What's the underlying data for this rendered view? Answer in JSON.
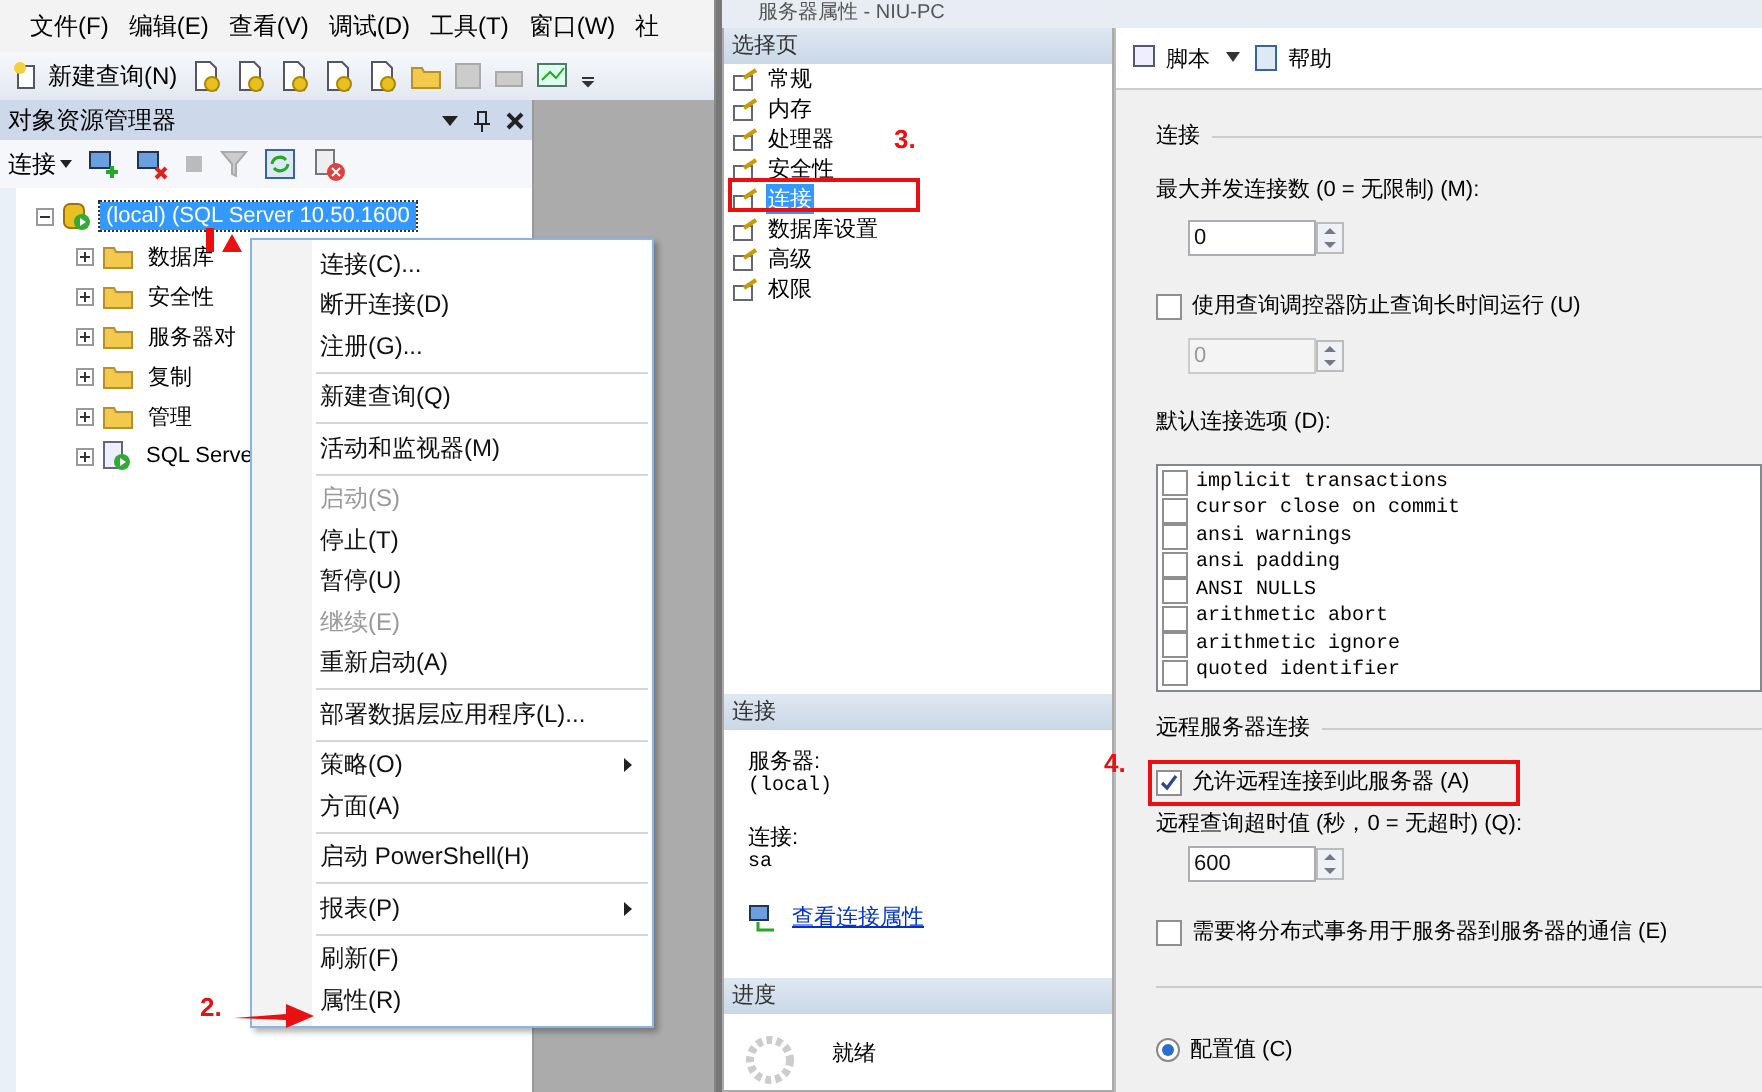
{
  "ssms": {
    "menu_bar": [
      "文件(F)",
      "编辑(E)",
      "查看(V)",
      "调试(D)",
      "工具(T)",
      "窗口(W)",
      "社"
    ],
    "toolbar": {
      "new_query": "新建查询(N)"
    },
    "object_explorer": {
      "title": "对象资源管理器",
      "connect": "连接",
      "tree": [
        {
          "label": "(local) (SQL Server 10.50.1600",
          "kind": "server",
          "expanded": true,
          "selected": true,
          "children": [
            {
              "label": "数据库",
              "kind": "folder",
              "expanded": false,
              "selected": false
            },
            {
              "label": "安全性",
              "kind": "folder",
              "expanded": false,
              "selected": false
            },
            {
              "label": "服务器对",
              "kind": "folder",
              "expanded": false,
              "selected": false
            },
            {
              "label": "复制",
              "kind": "folder",
              "expanded": false,
              "selected": false
            },
            {
              "label": "管理",
              "kind": "folder",
              "expanded": false,
              "selected": false
            },
            {
              "label": "SQL Serve",
              "kind": "agent",
              "expanded": false,
              "selected": false
            }
          ]
        }
      ]
    },
    "context_menu": [
      {
        "kind": "item",
        "label": "连接(C)...",
        "disabled": false,
        "submenu": false
      },
      {
        "kind": "item",
        "label": "断开连接(D)",
        "disabled": false,
        "submenu": false
      },
      {
        "kind": "item",
        "label": "注册(G)...",
        "disabled": false,
        "submenu": false
      },
      {
        "kind": "separator"
      },
      {
        "kind": "item",
        "label": "新建查询(Q)",
        "disabled": false,
        "submenu": false
      },
      {
        "kind": "separator"
      },
      {
        "kind": "item",
        "label": "活动和监视器(M)",
        "disabled": false,
        "submenu": false
      },
      {
        "kind": "separator"
      },
      {
        "kind": "item",
        "label": "启动(S)",
        "disabled": true,
        "submenu": false
      },
      {
        "kind": "item",
        "label": "停止(T)",
        "disabled": false,
        "submenu": false
      },
      {
        "kind": "item",
        "label": "暂停(U)",
        "disabled": false,
        "submenu": false
      },
      {
        "kind": "item",
        "label": "继续(E)",
        "disabled": true,
        "submenu": false
      },
      {
        "kind": "item",
        "label": "重新启动(A)",
        "disabled": false,
        "submenu": false
      },
      {
        "kind": "separator"
      },
      {
        "kind": "item",
        "label": "部署数据层应用程序(L)...",
        "disabled": false,
        "submenu": false
      },
      {
        "kind": "separator"
      },
      {
        "kind": "item",
        "label": "策略(O)",
        "disabled": false,
        "submenu": true
      },
      {
        "kind": "item",
        "label": "方面(A)",
        "disabled": false,
        "submenu": false
      },
      {
        "kind": "separator"
      },
      {
        "kind": "item",
        "label": "启动 PowerShell(H)",
        "disabled": false,
        "submenu": false
      },
      {
        "kind": "separator"
      },
      {
        "kind": "item",
        "label": "报表(P)",
        "disabled": false,
        "submenu": true
      },
      {
        "kind": "separator"
      },
      {
        "kind": "item",
        "label": "刷新(F)",
        "disabled": false,
        "submenu": false
      },
      {
        "kind": "item",
        "label": "属性(R)",
        "disabled": false,
        "submenu": false
      }
    ]
  },
  "dialog": {
    "title": "服务器属性 - NIU-PC",
    "select_page": {
      "title": "选择页",
      "items": [
        {
          "label": "常规",
          "selected": false
        },
        {
          "label": "内存",
          "selected": false
        },
        {
          "label": "处理器",
          "selected": false
        },
        {
          "label": "安全性",
          "selected": false
        },
        {
          "label": "连接",
          "selected": true
        },
        {
          "label": "数据库设置",
          "selected": false
        },
        {
          "label": "高级",
          "selected": false
        },
        {
          "label": "权限",
          "selected": false
        }
      ]
    },
    "connection_info": {
      "title": "连接",
      "server_label": "服务器:",
      "server": "(local)",
      "connection_label": "连接:",
      "connection": "sa",
      "link": "查看连接属性"
    },
    "progress": {
      "title": "进度",
      "status": "就绪"
    },
    "toolbar": {
      "script": "脚本",
      "help": "帮助"
    },
    "content": [
      {
        "kind": "group",
        "label": "连接"
      },
      {
        "kind": "label",
        "label": "最大并发连接数 (0 = 无限制) (M):"
      },
      {
        "kind": "spin",
        "value": "0",
        "disabled": false
      },
      {
        "kind": "check",
        "label": "使用查询调控器防止查询长时间运行 (U)",
        "checked": false
      },
      {
        "kind": "spin",
        "value": "0",
        "disabled": true
      },
      {
        "kind": "label",
        "label": "默认连接选项 (D):"
      },
      {
        "kind": "listbox",
        "options": [
          {
            "label": "implicit transactions",
            "checked": false
          },
          {
            "label": "cursor close on commit",
            "checked": false
          },
          {
            "label": "ansi warnings",
            "checked": false
          },
          {
            "label": "ansi padding",
            "checked": false
          },
          {
            "label": "ANSI NULLS",
            "checked": false
          },
          {
            "label": "arithmetic abort",
            "checked": false
          },
          {
            "label": "arithmetic ignore",
            "checked": false
          },
          {
            "label": "quoted identifier",
            "checked": false
          }
        ]
      },
      {
        "kind": "group",
        "label": "远程服务器连接"
      },
      {
        "kind": "check",
        "label": "允许远程连接到此服务器 (A)",
        "checked": true
      },
      {
        "kind": "label",
        "label": "远程查询超时值 (秒，0 = 无超时) (Q):"
      },
      {
        "kind": "spin",
        "value": "600",
        "disabled": false
      },
      {
        "kind": "check",
        "label": "需要将分布式事务用于服务器到服务器的通信 (E)",
        "checked": false
      },
      {
        "kind": "divider"
      },
      {
        "kind": "radio",
        "label": "配置值 (C)",
        "selected": true
      }
    ]
  },
  "annotations": [
    {
      "kind": "arrow"
    },
    {
      "kind": "arrow",
      "label": "2."
    },
    {
      "kind": "frame",
      "label": "3."
    },
    {
      "kind": "frame",
      "label": "4."
    }
  ]
}
